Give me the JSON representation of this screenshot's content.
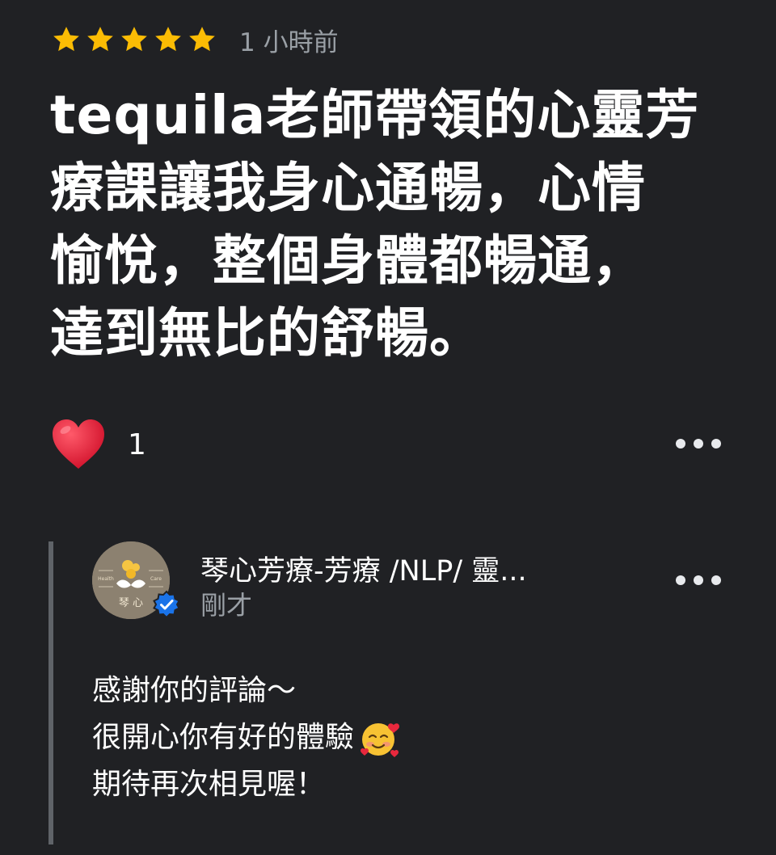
{
  "review": {
    "rating": 5,
    "rating_max": 5,
    "time": "1 小時前",
    "text": "tequila老師帶領的心靈芳療課讓我身心通暢，心情愉悅，整個身體都暢通，達到無比的舒暢。",
    "lines": [
      "tequila老師帶領的心靈芳",
      "療課讓我身心通暢，心情",
      "愉悅，整個身體都暢通，",
      "達到無比的舒暢。"
    ],
    "like_icon": "heart-icon",
    "like_count": "1",
    "more_icon": "more-horizontal-icon"
  },
  "reply": {
    "owner_name": "琴心芳療-芳療 /NLP/ 靈...",
    "time": "剛才",
    "avatar_text_left": "Health",
    "avatar_text_right": "Care",
    "avatar_text_bottom": "琴 心",
    "verified_icon": "verified-badge-icon",
    "lines": [
      "感謝你的評論～",
      "很開心你有好的體驗",
      "期待再次相見喔！"
    ],
    "emoji_icon": "smiling-face-with-hearts-icon",
    "more_icon": "more-horizontal-icon"
  },
  "colors": {
    "background": "#202124",
    "star": "#fbbc04",
    "heart": "#e8283d",
    "verified": "#1a73e8",
    "muted_text": "#9aa0a6",
    "reply_bar": "#5f6368"
  }
}
